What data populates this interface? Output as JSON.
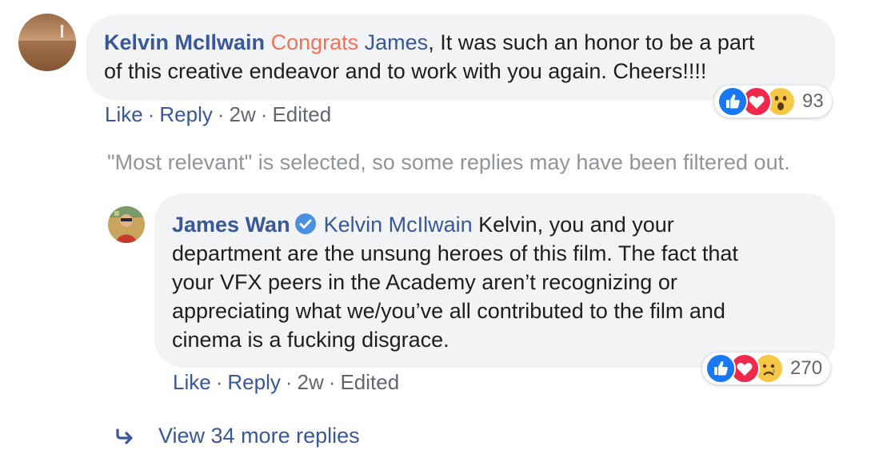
{
  "comment": {
    "author": "Kelvin McIlwain",
    "tag_congrats": "Congrats",
    "tag_name": "James",
    "text_line1": ", It was such an honor to be a part",
    "text_line2": "of this creative endeavor and to work with you again. Cheers!!!!",
    "actions": {
      "like": "Like",
      "reply": "Reply",
      "time": "2w",
      "edited": "Edited",
      "separator": "·"
    },
    "reaction_count": "93",
    "reaction_icons": [
      "like-icon",
      "love-icon",
      "wow-icon"
    ]
  },
  "filter_notice": "\"Most relevant\" is selected, so some replies may have been filtered out.",
  "reply": {
    "author": "James Wan",
    "verified_icon": "verified-badge-icon",
    "mention": "Kelvin McIlwain",
    "lines": [
      " Kelvin, you and your",
      "department are the unsung heroes of this film. The fact that",
      "your VFX peers in the Academy aren’t recognizing or",
      "appreciating what we/you’ve all contributed to the film and",
      "cinema is a fucking disgrace."
    ],
    "actions": {
      "like": "Like",
      "reply": "Reply",
      "time": "2w",
      "edited": "Edited",
      "separator": "·"
    },
    "reaction_count": "270",
    "reaction_icons": [
      "like-icon",
      "love-icon",
      "sad-icon"
    ]
  },
  "view_more": {
    "icon": "reply-arrow-icon",
    "label": "View 34 more replies"
  },
  "colors": {
    "link": "#385898",
    "congrats": "#f0735a",
    "bubble": "#f2f3f5",
    "meta": "#606770",
    "notice": "#90949c"
  }
}
